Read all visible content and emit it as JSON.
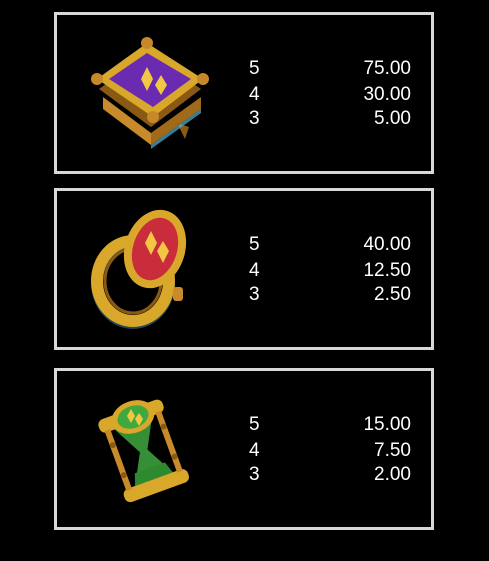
{
  "paytable": [
    {
      "symbol_icon": "spellbook-icon",
      "rows": [
        {
          "count": "5",
          "value": "75.00"
        },
        {
          "count": "4",
          "value": "30.00"
        },
        {
          "count": "3",
          "value": "5.00"
        }
      ]
    },
    {
      "symbol_icon": "ring-icon",
      "rows": [
        {
          "count": "5",
          "value": "40.00"
        },
        {
          "count": "4",
          "value": "12.50"
        },
        {
          "count": "3",
          "value": "2.50"
        }
      ]
    },
    {
      "symbol_icon": "hourglass-icon",
      "rows": [
        {
          "count": "5",
          "value": "15.00"
        },
        {
          "count": "4",
          "value": "7.50"
        },
        {
          "count": "3",
          "value": "2.00"
        }
      ]
    }
  ],
  "colors": {
    "background": "#000000",
    "panel_border": "#d8d8d8",
    "gold": "#d9a72a",
    "purple": "#6a2bb0",
    "red": "#c92d3c",
    "green": "#3fa83f"
  }
}
